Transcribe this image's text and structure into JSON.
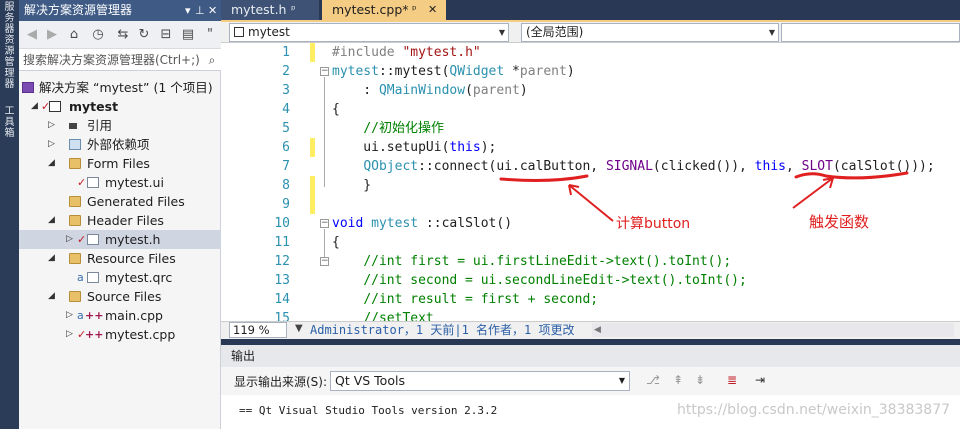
{
  "side_tabs": [
    "服务器资源管理器",
    "工具箱"
  ],
  "solution_explorer": {
    "title": "解决方案资源管理器",
    "search_placeholder": "搜索解决方案资源管理器(Ctrl+;)",
    "tree": [
      {
        "label": "解决方案 “mytest” (1 个项目)",
        "icon": "solution-icon",
        "bold": false
      },
      {
        "label": "mytest",
        "icon": "project-icon",
        "bold": true
      },
      {
        "label": "引用",
        "icon": "references-icon"
      },
      {
        "label": "外部依赖项",
        "icon": "external-deps-icon"
      },
      {
        "label": "Form Files",
        "icon": "folder-icon"
      },
      {
        "label": "mytest.ui",
        "icon": "ui-file-icon"
      },
      {
        "label": "Generated Files",
        "icon": "folder-icon"
      },
      {
        "label": "Header Files",
        "icon": "folder-icon"
      },
      {
        "label": "mytest.h",
        "icon": "header-file-icon"
      },
      {
        "label": "Resource Files",
        "icon": "folder-icon"
      },
      {
        "label": "mytest.qrc",
        "icon": "qrc-file-icon"
      },
      {
        "label": "Source Files",
        "icon": "folder-icon"
      },
      {
        "label": "main.cpp",
        "icon": "cpp-file-icon"
      },
      {
        "label": "mytest.cpp",
        "icon": "cpp-file-icon"
      }
    ]
  },
  "tabs": [
    {
      "label": "mytest.h",
      "active": false
    },
    {
      "label": "mytest.cpp*",
      "active": true
    }
  ],
  "nav": {
    "project": "mytest",
    "scope": "(全局范围)"
  },
  "editor": {
    "line_numbers": [
      "1",
      "2",
      "3",
      "4",
      "5",
      "6",
      "7",
      "8",
      "9",
      "10",
      "11",
      "12",
      "13",
      "14",
      "15"
    ],
    "annotation_left": "计算button",
    "annotation_right": "触发函数"
  },
  "zoom": "119 %",
  "codelens": "Administrator，1 天前|1 名作者，1 项更改",
  "output": {
    "title": "输出",
    "source_label": "显示输出来源(S):",
    "source_value": "Qt VS Tools",
    "text": "== Qt Visual Studio Tools version 2.3.2"
  },
  "watermark": "https://blog.csdn.net/weixin_38383877",
  "colors": {
    "accent_tab": "#f5cc84",
    "ink": "#e02020"
  }
}
